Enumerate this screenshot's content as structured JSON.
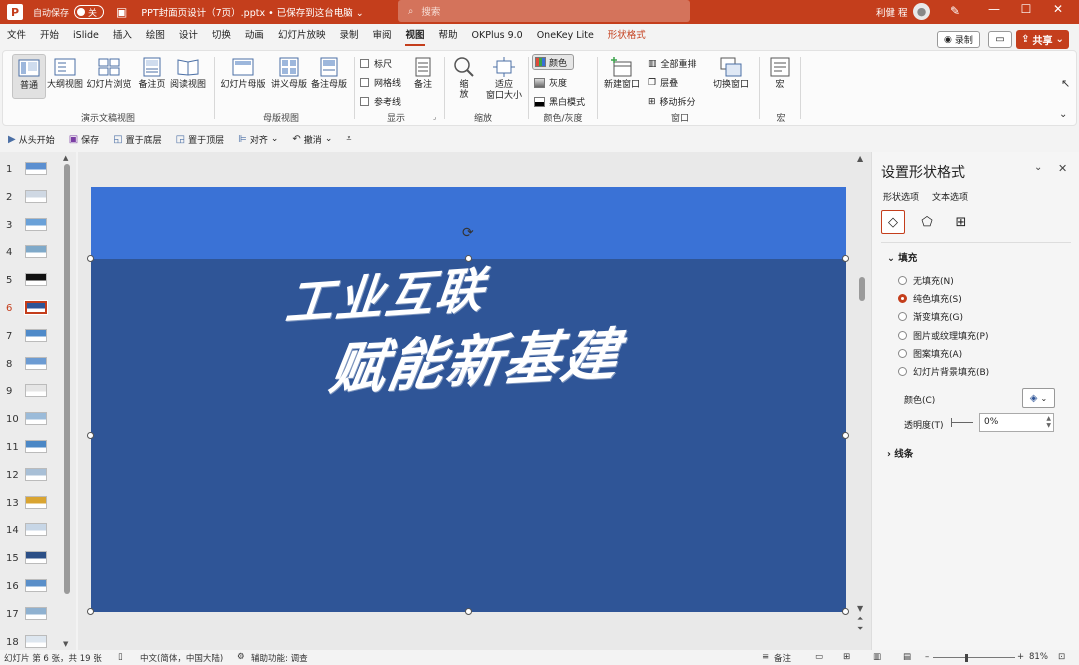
{
  "titlebar": {
    "logo": "P",
    "autosave_label": "自动保存",
    "autosave_state": "关",
    "filename": "PPT封面页设计（7页）.pptx • 已保存到这台电脑 ⌄",
    "search_placeholder": "搜索",
    "user": "利健 程",
    "minimize": "—",
    "restore": "☐",
    "close": "✕"
  },
  "tabs": [
    "文件",
    "开始",
    "iSlide",
    "插入",
    "绘图",
    "设计",
    "切换",
    "动画",
    "幻灯片放映",
    "录制",
    "审阅",
    "视图",
    "帮助",
    "OKPlus 9.0",
    "OneKey Lite",
    "形状格式"
  ],
  "active_tab": "视图",
  "right_buttons": {
    "record": "录制",
    "share": "共享"
  },
  "ribbon": {
    "presentation_views": [
      "普通",
      "大纲视图",
      "幻灯片浏览",
      "备注页",
      "阅读视图"
    ],
    "presentation_views_label": "演示文稿视图",
    "master_views": [
      "幻灯片母版",
      "讲义母版",
      "备注母版"
    ],
    "master_views_label": "母版视图",
    "show": {
      "ruler": "标尺",
      "gridlines": "网格线",
      "guides": "参考线",
      "notes": "备注",
      "label": "显示"
    },
    "zoom": {
      "zoom": "缩放",
      "fit_line1": "适应",
      "fit_line2": "窗口大小",
      "label": "缩放"
    },
    "color": {
      "color": "颜色",
      "gray": "灰度",
      "bw": "黑白模式",
      "label": "颜色/灰度"
    },
    "window": {
      "new_window": "新建窗口",
      "arrange_all": "全部重排",
      "cascade": "层叠",
      "move_split": "移动拆分",
      "switch_window": "切换窗口",
      "label": "窗口"
    },
    "macro": {
      "macro": "宏",
      "label": "宏"
    }
  },
  "qat": [
    "从头开始",
    "保存",
    "置于底层",
    "置于顶层",
    "对齐",
    "撤消"
  ],
  "thumbs": [
    {
      "n": "1",
      "c": "#5b8fd0"
    },
    {
      "n": "2",
      "c": "#cfd8e3"
    },
    {
      "n": "3",
      "c": "#6aa1d8"
    },
    {
      "n": "4",
      "c": "#7fa9c9"
    },
    {
      "n": "5",
      "c": "#111111"
    },
    {
      "n": "6",
      "c": "#2f5597"
    },
    {
      "n": "7",
      "c": "#4f8ac9"
    },
    {
      "n": "8",
      "c": "#6c9bd2"
    },
    {
      "n": "9",
      "c": "#e5e5e5"
    },
    {
      "n": "10",
      "c": "#9bbbd9"
    },
    {
      "n": "11",
      "c": "#4b87c5"
    },
    {
      "n": "12",
      "c": "#a8bfd6"
    },
    {
      "n": "13",
      "c": "#d9a431"
    },
    {
      "n": "14",
      "c": "#c7d6e6"
    },
    {
      "n": "15",
      "c": "#2c4f86"
    },
    {
      "n": "16",
      "c": "#5a8fc9"
    },
    {
      "n": "17",
      "c": "#8fb1d0"
    },
    {
      "n": "18",
      "c": "#dde6ef"
    }
  ],
  "active_slide": "6",
  "slide": {
    "line1": "工业互联",
    "line2": "赋能新基建",
    "top_color": "#3a72d6",
    "rect_color": "#2f5597"
  },
  "pane": {
    "title": "设置形状格式",
    "tab_shape": "形状选项",
    "tab_text": "文本选项",
    "fill_section": "填充",
    "fill_options": [
      "无填充(N)",
      "纯色填充(S)",
      "渐变填充(G)",
      "图片或纹理填充(P)",
      "图案填充(A)",
      "幻灯片背景填充(B)"
    ],
    "selected_fill": "纯色填充(S)",
    "color_label": "颜色(C)",
    "transparency_label": "透明度(T)",
    "transparency_value": "0%",
    "line_section": "线条"
  },
  "status": {
    "slide_info": "幻灯片 第 6 张，共 19 张",
    "language": "中文(简体，中国大陆)",
    "accessibility": "辅助功能: 调查",
    "notes": "备注",
    "zoom": "81%"
  },
  "colors": {
    "accent": "#c43e1c"
  }
}
